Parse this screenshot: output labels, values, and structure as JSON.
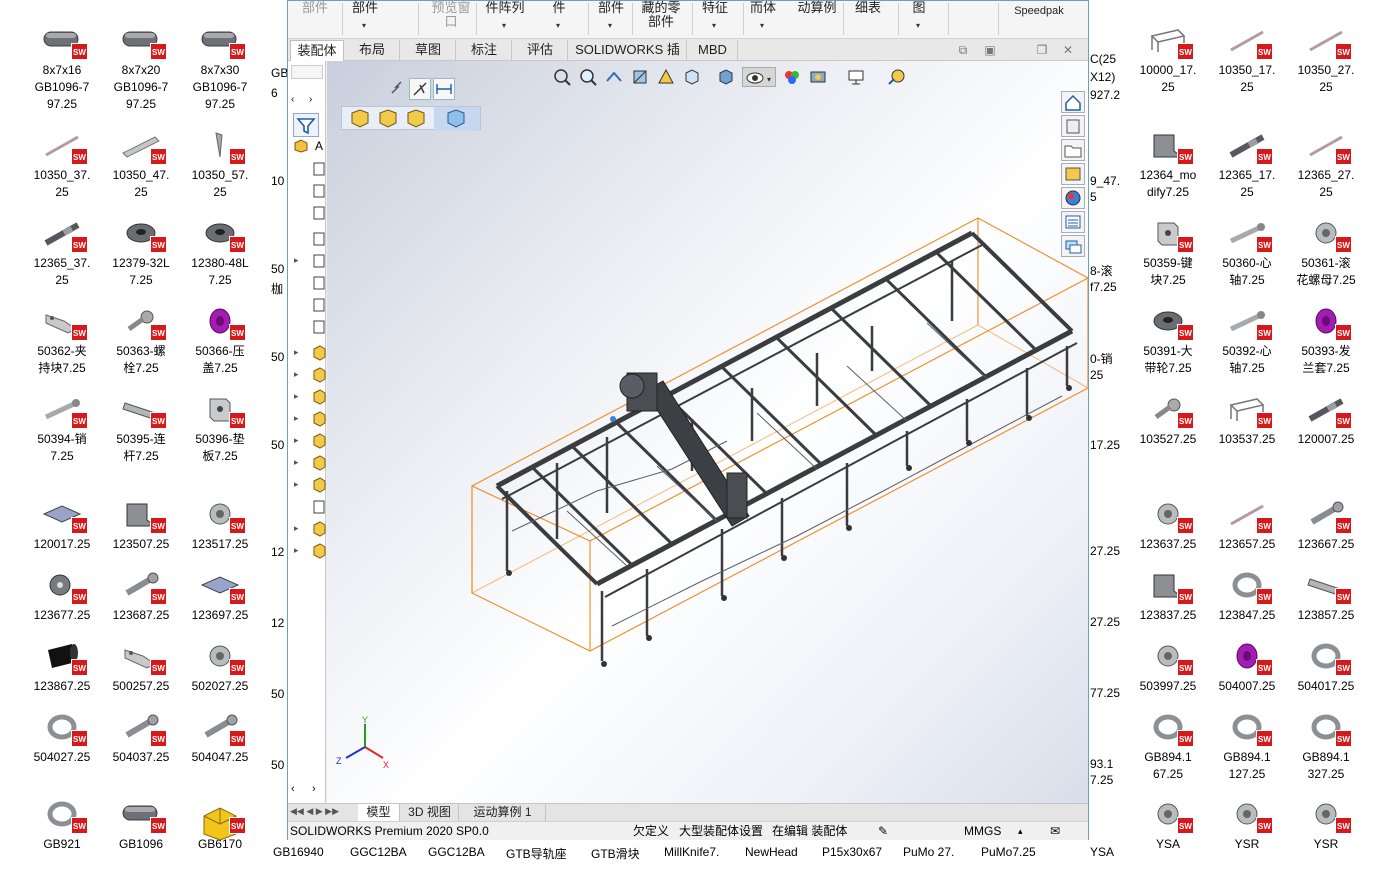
{
  "desktop_icons": [
    {
      "label": "8x7x16\nGB1096-7\n97.25",
      "shape": "key"
    },
    {
      "label": "8x7x20\nGB1096-7\n97.25",
      "shape": "key"
    },
    {
      "label": "8x7x30\nGB1096-7\n97.25",
      "shape": "key"
    },
    {
      "label": "10350_37.\n25",
      "shape": "rod"
    },
    {
      "label": "10350_47.\n25",
      "shape": "bar"
    },
    {
      "label": "10350_57.\n25",
      "shape": "wedge"
    },
    {
      "label": "12365_37.\n25",
      "shape": "shaft"
    },
    {
      "label": "12379-32L\n7.25",
      "shape": "pulley"
    },
    {
      "label": "12380-48L\n7.25",
      "shape": "pulley"
    },
    {
      "label": "50362-夹\n持块7.25",
      "shape": "clamp"
    },
    {
      "label": "50363-螺\n栓7.25",
      "shape": "bolt"
    },
    {
      "label": "50366-压\n盖7.25",
      "shape": "cap"
    },
    {
      "label": "50394-销\n7.25",
      "shape": "pin"
    },
    {
      "label": "50395-连\n杆7.25",
      "shape": "link"
    },
    {
      "label": "50396-垫\n板7.25",
      "shape": "block"
    },
    {
      "label": "120017.25",
      "shape": "plate"
    },
    {
      "label": "123507.25",
      "shape": "bracket"
    },
    {
      "label": "123517.25",
      "shape": "bushing"
    },
    {
      "label": "123677.25",
      "shape": "wheel"
    },
    {
      "label": "123687.25",
      "shape": "screw"
    },
    {
      "label": "123697.25",
      "shape": "plate"
    },
    {
      "label": "123867.25",
      "shape": "cylinder"
    },
    {
      "label": "500257.25",
      "shape": "clamp"
    },
    {
      "label": "502027.25",
      "shape": "bushing"
    },
    {
      "label": "504027.25",
      "shape": "ring"
    },
    {
      "label": "504037.25",
      "shape": "screw"
    },
    {
      "label": "504047.25",
      "shape": "screw"
    },
    {
      "label": "GB921",
      "shape": "ring"
    },
    {
      "label": "GB1096",
      "shape": "key"
    },
    {
      "label": "GB6170",
      "shape": "yellowblock"
    },
    {
      "label": "10000_17.\n25",
      "shape": "frame"
    },
    {
      "label": "10350_17.\n25",
      "shape": "rod"
    },
    {
      "label": "10350_27.\n25",
      "shape": "rod"
    },
    {
      "label": "12364_mo\ndify7.25",
      "shape": "bracket"
    },
    {
      "label": "12365_17.\n25",
      "shape": "shaft"
    },
    {
      "label": "12365_27.\n25",
      "shape": "rod"
    },
    {
      "label": "50359-键\n块7.25",
      "shape": "block"
    },
    {
      "label": "50360-心\n轴7.25",
      "shape": "pin"
    },
    {
      "label": "50361-滚\n花螺母7.25",
      "shape": "bushing"
    },
    {
      "label": "50391-大\n带轮7.25",
      "shape": "pulley"
    },
    {
      "label": "50392-心\n轴7.25",
      "shape": "pin"
    },
    {
      "label": "50393-发\n兰套7.25",
      "shape": "cap"
    },
    {
      "label": "103527.25",
      "shape": "bolt"
    },
    {
      "label": "103537.25",
      "shape": "frame"
    },
    {
      "label": "120007.25",
      "shape": "shaft"
    },
    {
      "label": "123637.25",
      "shape": "bushing"
    },
    {
      "label": "123657.25",
      "shape": "rod"
    },
    {
      "label": "123667.25",
      "shape": "screw"
    },
    {
      "label": "123837.25",
      "shape": "bracket"
    },
    {
      "label": "123847.25",
      "shape": "ring"
    },
    {
      "label": "123857.25",
      "shape": "link"
    },
    {
      "label": "503997.25",
      "shape": "bushing"
    },
    {
      "label": "504007.25",
      "shape": "cap"
    },
    {
      "label": "504017.25",
      "shape": "ring"
    },
    {
      "label": "GB894.1\n67.25",
      "shape": "ring"
    },
    {
      "label": "GB894.1\n127.25",
      "shape": "ring"
    },
    {
      "label": "GB894.1\n327.25",
      "shape": "ring"
    },
    {
      "label": "YSA",
      "shape": "bushing"
    },
    {
      "label": "YSR",
      "shape": "bushing"
    },
    {
      "label": "YSR",
      "shape": "bushing"
    }
  ],
  "partial_icons": {
    "col4": [
      "GB",
      "6",
      "10",
      "50",
      "枷",
      "50",
      "50",
      "12",
      "12",
      "50",
      "50"
    ],
    "col_right": [
      "C(25",
      "X12)",
      "927.2",
      "9_47.",
      "5",
      "8-滚",
      "f7.25",
      "0-销",
      "25",
      "17.25",
      "27.25",
      "27.25",
      "77.25",
      "93.1",
      "7.25",
      "YSA"
    ]
  },
  "bottom_row": [
    "GB16940",
    "GGC12BA",
    "GGC12BA",
    "GTB导轨座",
    "GTB滑块",
    "MillKnife7.",
    "NewHead",
    "P15x30x67",
    "PuMo 27.",
    "PuMo7.25"
  ],
  "sw": {
    "ribbon": [
      {
        "label": "部件",
        "gray": true
      },
      {
        "label": "部件",
        "gray": false
      },
      {
        "label": "预览窗\n口",
        "gray": true
      },
      {
        "label": "件阵列",
        "gray": false
      },
      {
        "label": "件",
        "gray": false
      },
      {
        "label": "部件",
        "gray": false
      },
      {
        "label": "藏的零\n部件",
        "gray": false
      },
      {
        "label": "特征",
        "gray": false
      },
      {
        "label": "而体",
        "gray": false
      },
      {
        "label": "动算例",
        "gray": false
      },
      {
        "label": "细表",
        "gray": false
      },
      {
        "label": "图",
        "gray": false
      },
      {
        "label": "Speedpak",
        "gray": false
      }
    ],
    "tabs": [
      "装配体",
      "布局",
      "草图",
      "标注",
      "评估",
      "SOLIDWORKS 插件",
      "MBD"
    ],
    "active_tab": "装配体",
    "tree_label": "A",
    "bottom_tabs": [
      "模型",
      "3D 视图",
      "运动算例 1"
    ],
    "active_bottom_tab": "模型",
    "status": {
      "product": "SOLIDWORKS Premium 2020 SP0.0",
      "constraint": "欠定义",
      "large_assembly": "大型装配体设置",
      "editing": "在编辑 装配体",
      "units": "MMGS"
    },
    "triad": {
      "x": "X",
      "y": "Y",
      "z": "Z"
    }
  },
  "colors": {
    "sw_red": "#d6191a",
    "bbox_orange": "#f08a20",
    "frame_dark": "#3a3c40"
  }
}
